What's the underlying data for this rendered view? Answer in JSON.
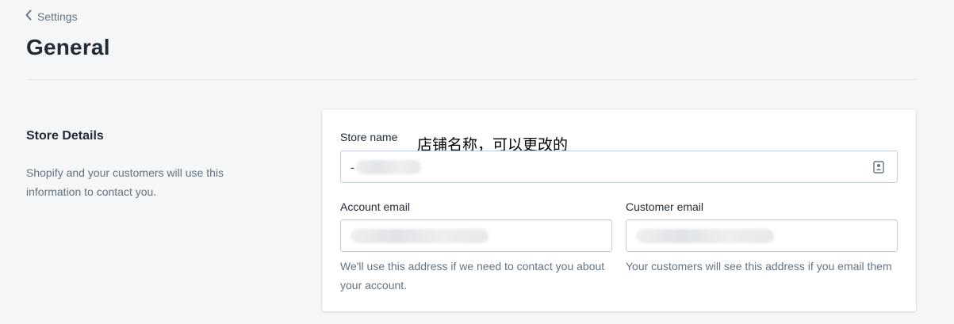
{
  "breadcrumb": {
    "label": "Settings"
  },
  "page": {
    "title": "General"
  },
  "section": {
    "heading": "Store Details",
    "description": "Shopify and your customers will use this information to contact you."
  },
  "annotation": {
    "text": "店铺名称，可以更改的"
  },
  "form": {
    "store_name": {
      "label": "Store name",
      "value": "-"
    },
    "account_email": {
      "label": "Account email",
      "value": "",
      "help": "We'll use this address if we need to contact you about your account."
    },
    "customer_email": {
      "label": "Customer email",
      "value": "",
      "help": "Your customers will see this address if you email them"
    }
  },
  "colors": {
    "background": "#f4f6f8",
    "text": "#212b36",
    "subdued": "#637381",
    "border": "#c4cdd5"
  },
  "icons": {
    "back": "chevron-left-icon",
    "contact": "contact-card-icon"
  }
}
